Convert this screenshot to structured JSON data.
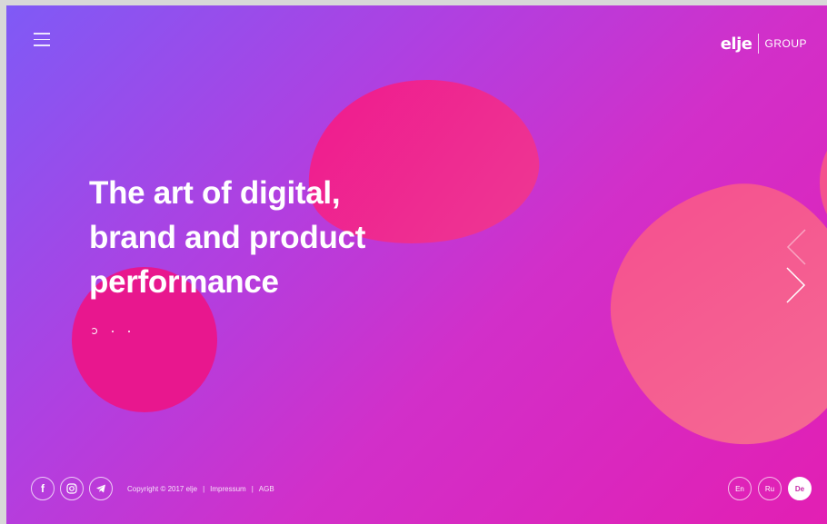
{
  "brand": {
    "logo_mark": "elje",
    "logo_suffix": "GROUP"
  },
  "hero": {
    "headline_line1": "The art of digital,",
    "headline_line2": "brand and product",
    "headline_line3": "performance"
  },
  "slider": {
    "slide_count": 3,
    "active_index": 0
  },
  "footer": {
    "copyright": "Copyright © 2017 elje",
    "separator": "|",
    "impressum": "Impressum",
    "agb": "AGB"
  },
  "social": [
    {
      "name": "facebook-icon",
      "glyph": "f"
    },
    {
      "name": "instagram-icon"
    },
    {
      "name": "telegram-icon"
    }
  ],
  "languages": [
    {
      "label": "En",
      "active": false
    },
    {
      "label": "Ru",
      "active": false
    },
    {
      "label": "De",
      "active": true
    }
  ],
  "colors": {
    "gradient_start": "#7f5af6",
    "gradient_end": "#e21fb3",
    "blob_pink": "#ef1a8e",
    "blob_coral": "#f5508f"
  }
}
